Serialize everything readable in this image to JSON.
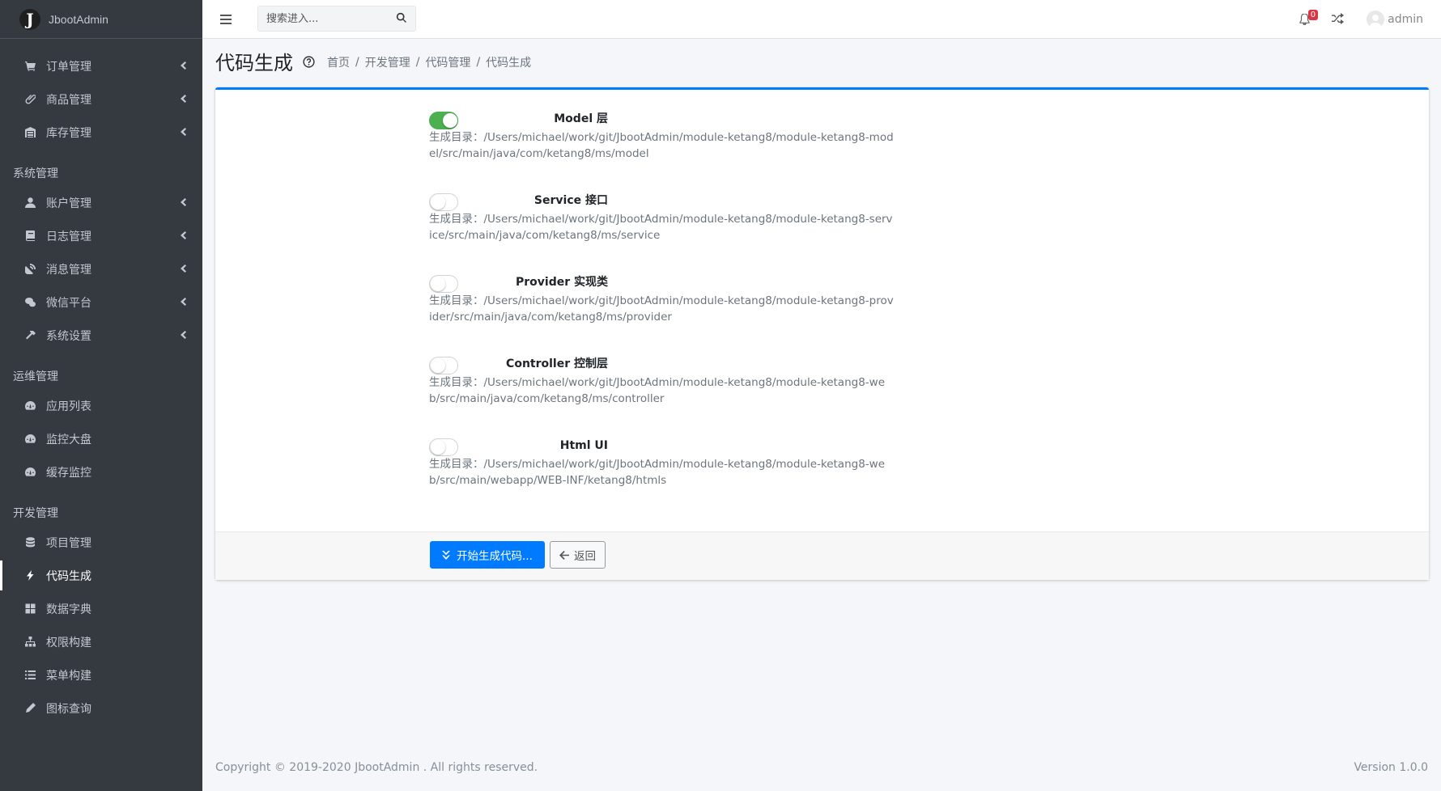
{
  "brand": {
    "name": "JbootAdmin",
    "logo_letter": "J"
  },
  "sidebar": {
    "top_items": [
      {
        "label": "订单管理",
        "icon": "cart-icon",
        "has_arrow": true
      },
      {
        "label": "商品管理",
        "icon": "paperclip-icon",
        "has_arrow": true
      },
      {
        "label": "库存管理",
        "icon": "warehouse-icon",
        "has_arrow": true
      }
    ],
    "sections": [
      {
        "header": "系统管理",
        "items": [
          {
            "label": "账户管理",
            "icon": "user-icon",
            "has_arrow": true
          },
          {
            "label": "日志管理",
            "icon": "book-icon",
            "has_arrow": true
          },
          {
            "label": "消息管理",
            "icon": "satellite-dish-icon",
            "has_arrow": true
          },
          {
            "label": "微信平台",
            "icon": "wechat-icon",
            "has_arrow": true
          },
          {
            "label": "系统设置",
            "icon": "hammer-icon",
            "has_arrow": true
          }
        ]
      },
      {
        "header": "运维管理",
        "items": [
          {
            "label": "应用列表",
            "icon": "tachometer-icon"
          },
          {
            "label": "监控大盘",
            "icon": "tachometer-icon"
          },
          {
            "label": "缓存监控",
            "icon": "tachometer-icon"
          }
        ]
      },
      {
        "header": "开发管理",
        "items": [
          {
            "label": "项目管理",
            "icon": "database-icon"
          },
          {
            "label": "代码生成",
            "icon": "bolt-icon",
            "active": true
          },
          {
            "label": "数据字典",
            "icon": "grid-icon"
          },
          {
            "label": "权限构建",
            "icon": "sitemap-icon"
          },
          {
            "label": "菜单构建",
            "icon": "list-icon"
          },
          {
            "label": "图标查询",
            "icon": "pen-icon"
          }
        ]
      }
    ]
  },
  "topbar": {
    "search_placeholder": "搜索进入...",
    "notification_count": "0",
    "username": "admin"
  },
  "page": {
    "title": "代码生成",
    "breadcrumb": [
      "首页",
      "开发管理",
      "代码管理",
      "代码生成"
    ]
  },
  "form": {
    "rows": [
      {
        "label": "Model 层",
        "enabled": true,
        "path": "生成目录：/Users/michael/work/git/JbootAdmin/module-ketang8/module-ketang8-model/src/main/java/com/ketang8/ms/model"
      },
      {
        "label": "Service 接口",
        "enabled": false,
        "path": "生成目录：/Users/michael/work/git/JbootAdmin/module-ketang8/module-ketang8-service/src/main/java/com/ketang8/ms/service"
      },
      {
        "label": "Provider 实现类",
        "enabled": false,
        "path": "生成目录：/Users/michael/work/git/JbootAdmin/module-ketang8/module-ketang8-provider/src/main/java/com/ketang8/ms/provider"
      },
      {
        "label": "Controller 控制层",
        "enabled": false,
        "path": "生成目录：/Users/michael/work/git/JbootAdmin/module-ketang8/module-ketang8-web/src/main/java/com/ketang8/ms/controller"
      },
      {
        "label": "Html UI",
        "enabled": false,
        "path": "生成目录：/Users/michael/work/git/JbootAdmin/module-ketang8/module-ketang8-web/src/main/webapp/WEB-INF/ketang8/htmls"
      }
    ],
    "submit_label": "开始生成代码...",
    "back_label": "返回"
  },
  "footer": {
    "copyright": "Copyright © 2019-2020 JbootAdmin . All rights reserved.",
    "version": "Version 1.0.0"
  },
  "colors": {
    "sidebar_bg": "#343a40",
    "primary": "#007bff",
    "switch_on": "#4caf50",
    "badge": "#dc3545"
  }
}
